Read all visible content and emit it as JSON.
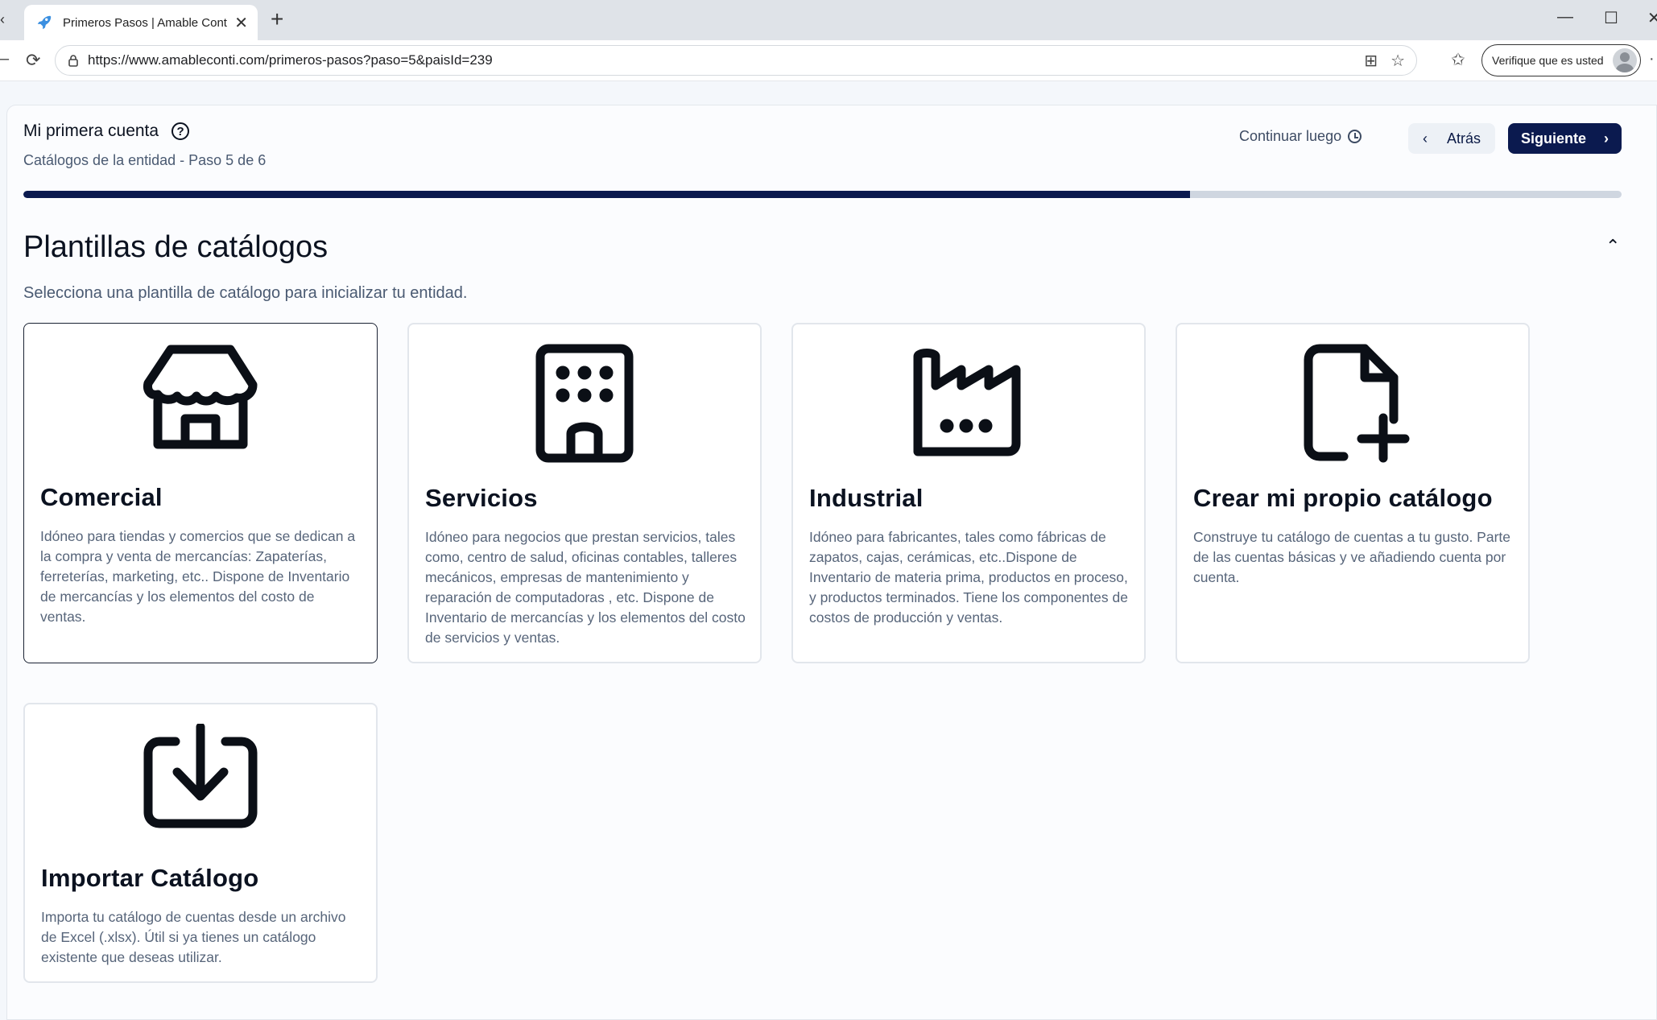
{
  "browser": {
    "tab_title": "Primeros Pasos | Amable Conti - E",
    "url": "https://www.amableconti.com/primeros-pasos?paso=5&paisId=239",
    "profile_label": "Verifique que es usted"
  },
  "wizard": {
    "title": "Mi primera cuenta",
    "subtitle": "Catálogos de la entidad - Paso 5 de 6",
    "continue_later": "Continuar luego",
    "back_label": "Atrás",
    "next_label": "Siguiente",
    "progress": 0.73
  },
  "section": {
    "title": "Plantillas de catálogos",
    "subtitle": "Selecciona una plantilla de catálogo para inicializar tu entidad."
  },
  "templates": [
    {
      "icon": "store-icon",
      "title": "Comercial",
      "description": "Idóneo para tiendas y comercios que se dedican a la compra y venta de mercancías: Zapaterías, ferreterías, marketing, etc.. Dispone de Inventario de mercancías y los elementos del costo de ventas."
    },
    {
      "icon": "building-icon",
      "title": "Servicios",
      "description": "Idóneo para negocios que prestan servicios, tales como, centro de salud, oficinas contables, talleres mecánicos, empresas de mantenimiento y reparación de computadoras , etc. Dispone de Inventario de mercancías y los elementos del costo de servicios y ventas."
    },
    {
      "icon": "factory-icon",
      "title": "Industrial",
      "description": "Idóneo para fabricantes, tales como fábricas de zapatos, cajas, cerámicas, etc..Dispone de Inventario de materia prima, productos en proceso, y productos terminados. Tiene los componentes de costos de producción y ventas."
    },
    {
      "icon": "file-plus-icon",
      "title": "Crear mi propio catálogo",
      "description": "Construye tu catálogo de cuentas a tu gusto. Parte de las cuentas básicas y ve añadiendo cuenta por cuenta."
    },
    {
      "icon": "import-icon",
      "title": "Importar Catálogo",
      "description": "Importa tu catálogo de cuentas desde un archivo de Excel (.xlsx). Útil si ya tienes un catálogo existente que deseas utilizar."
    }
  ],
  "colors": {
    "primary": "#0b1a4f",
    "progress_track": "#cfd6e0",
    "muted_text": "#57657a"
  }
}
